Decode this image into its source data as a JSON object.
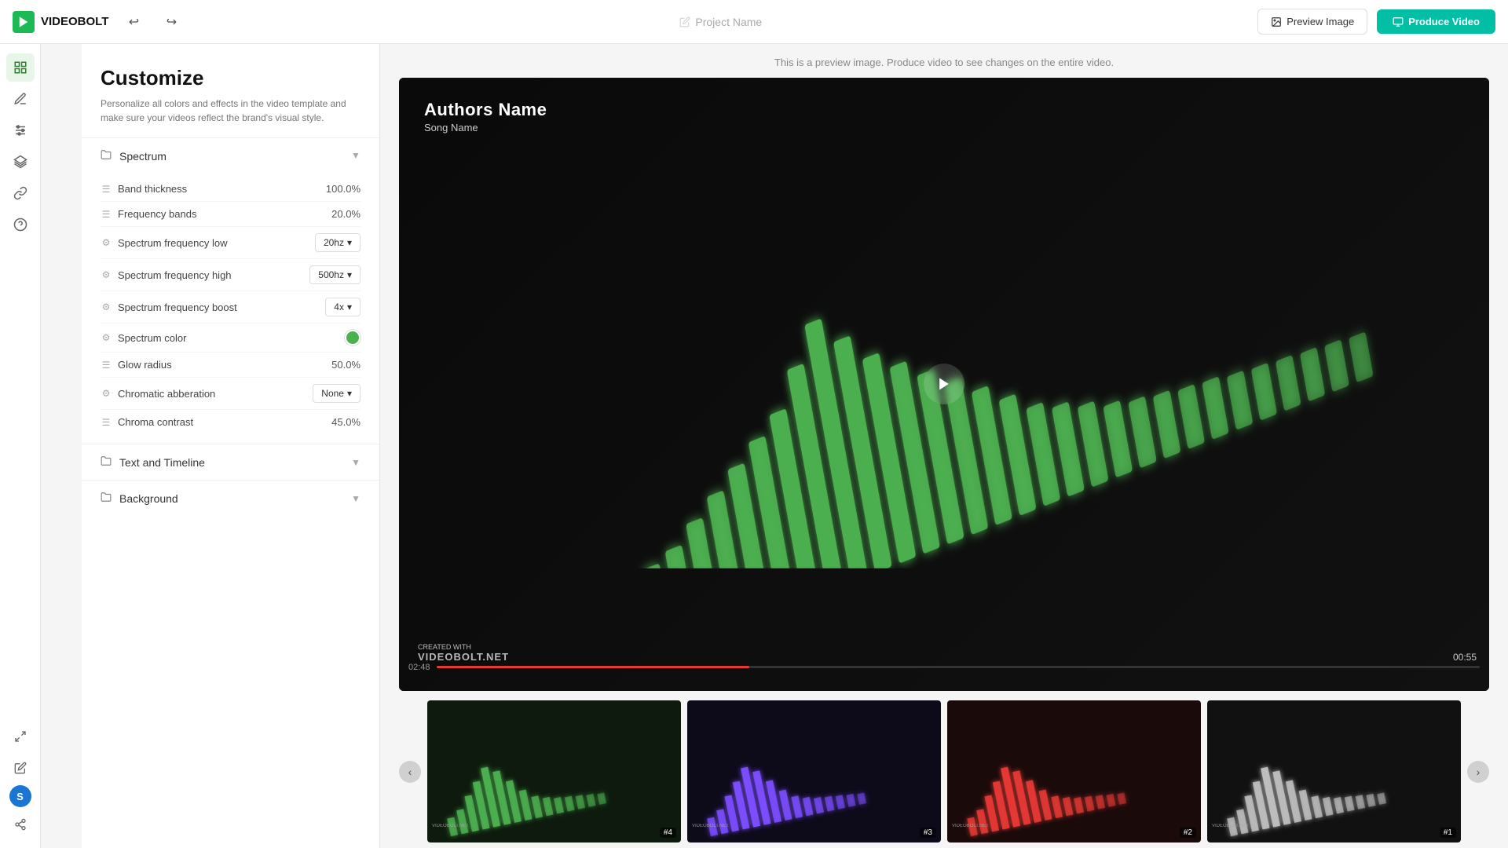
{
  "header": {
    "logo_text": "VIDEOBOLT",
    "project_name_placeholder": "Project Name",
    "btn_preview": "Preview Image",
    "btn_produce": "Produce Video"
  },
  "sidebar": {
    "icons": [
      "grid",
      "pen",
      "sliders",
      "layers",
      "link",
      "question"
    ]
  },
  "customize": {
    "title": "Customize",
    "description": "Personalize all colors and effects in the video template and make sure your videos reflect the brand's visual style."
  },
  "sections": {
    "spectrum": {
      "label": "Spectrum",
      "expanded": true,
      "properties": [
        {
          "id": "band_thickness",
          "label": "Band thickness",
          "icon": "sliders",
          "type": "value",
          "value": "100.0%"
        },
        {
          "id": "frequency_bands",
          "label": "Frequency bands",
          "icon": "sliders",
          "type": "value",
          "value": "20.0%"
        },
        {
          "id": "spectrum_freq_low",
          "label": "Spectrum frequency low",
          "icon": "gear",
          "type": "dropdown",
          "value": "20hz"
        },
        {
          "id": "spectrum_freq_high",
          "label": "Spectrum frequency high",
          "icon": "gear",
          "type": "dropdown",
          "value": "500hz"
        },
        {
          "id": "spectrum_freq_boost",
          "label": "Spectrum frequency boost",
          "icon": "gear",
          "type": "dropdown",
          "value": "4x"
        },
        {
          "id": "spectrum_color",
          "label": "Spectrum color",
          "icon": "gear",
          "type": "color",
          "value": "#4caf50"
        },
        {
          "id": "glow_radius",
          "label": "Glow radius",
          "icon": "sliders",
          "type": "value",
          "value": "50.0%"
        },
        {
          "id": "chromatic_abberation",
          "label": "Chromatic abberation",
          "icon": "gear",
          "type": "dropdown",
          "value": "None"
        },
        {
          "id": "chroma_contrast",
          "label": "Chroma contrast",
          "icon": "sliders",
          "type": "value",
          "value": "45.0%"
        }
      ]
    },
    "text_timeline": {
      "label": "Text and Timeline",
      "expanded": false
    },
    "background": {
      "label": "Background",
      "expanded": false
    }
  },
  "preview": {
    "notice": "This is a preview image. Produce video to see changes on the entire video.",
    "video": {
      "title": "Authors Name",
      "subtitle": "Song Name",
      "watermark_small": "CREATED WITH",
      "watermark_large": "VIDEOBOLT.NET",
      "time_current": "02:48",
      "time_total": "00:55",
      "progress_percent": 30
    },
    "thumbnails": [
      {
        "id": 4,
        "color": "#4caf50",
        "label": "#4"
      },
      {
        "id": 3,
        "color": "#7c4dff",
        "label": "#3"
      },
      {
        "id": 2,
        "color": "#e53935",
        "label": "#2"
      },
      {
        "id": 1,
        "color": "#bdbdbd",
        "label": "#1"
      }
    ]
  },
  "footer_icons": [
    "expand",
    "edit",
    "user"
  ]
}
